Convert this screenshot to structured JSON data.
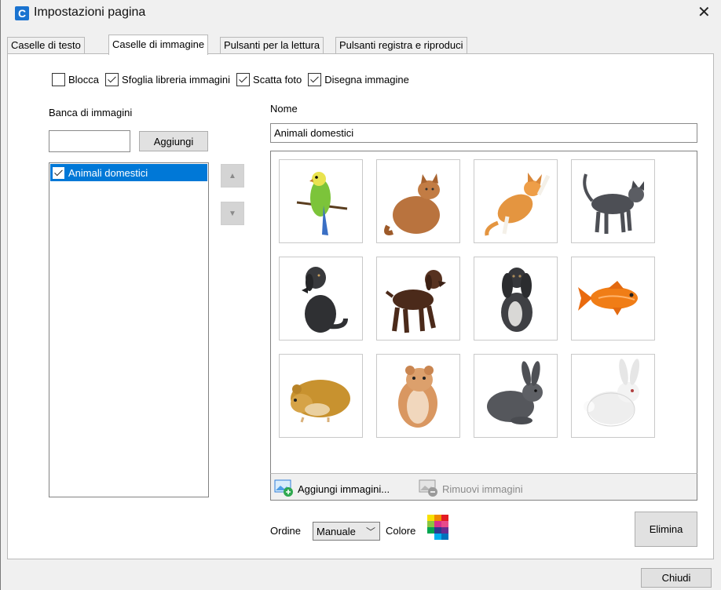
{
  "window": {
    "title": "Impostazioni pagina",
    "app_icon_letter": "C"
  },
  "tabs": [
    {
      "label": "Caselle di testo",
      "active": false
    },
    {
      "label": "Caselle di immagine",
      "active": true
    },
    {
      "label": "Pulsanti per la lettura",
      "active": false
    },
    {
      "label": "Pulsanti registra e riproduci",
      "active": false
    }
  ],
  "options": [
    {
      "label": "Blocca",
      "checked": false
    },
    {
      "label": "Sfoglia libreria immagini",
      "checked": true
    },
    {
      "label": "Scatta foto",
      "checked": true
    },
    {
      "label": "Disegna immagine",
      "checked": true
    }
  ],
  "bank": {
    "label": "Banca di immagini",
    "input_value": "",
    "add_button": "Aggiungi",
    "items": [
      {
        "label": "Animali domestici",
        "checked": true,
        "selected": true
      }
    ],
    "move_up_icon": "triangle-up",
    "move_down_icon": "triangle-down"
  },
  "name": {
    "label": "Nome",
    "value": "Animali domestici"
  },
  "images": [
    {
      "name": "parrot-image"
    },
    {
      "name": "cat-sitting-image"
    },
    {
      "name": "cat-playing-image"
    },
    {
      "name": "cat-grey-image"
    },
    {
      "name": "dog-black-image"
    },
    {
      "name": "dog-brown-image"
    },
    {
      "name": "dog-spaniel-image"
    },
    {
      "name": "goldfish-image"
    },
    {
      "name": "hamster-golden-image"
    },
    {
      "name": "hamster-standing-image"
    },
    {
      "name": "rabbit-grey-image"
    },
    {
      "name": "rabbit-white-image"
    }
  ],
  "toolbar": {
    "add_images": "Aggiungi immagini...",
    "remove_images": "Rimuovi immagini"
  },
  "footer": {
    "order_label": "Ordine",
    "order_value": "Manuale",
    "color_label": "Colore",
    "delete_button": "Elimina",
    "close_button": "Chiudi"
  },
  "colors": {
    "accent": "#0078d7",
    "app_icon": "#1a73d0"
  }
}
